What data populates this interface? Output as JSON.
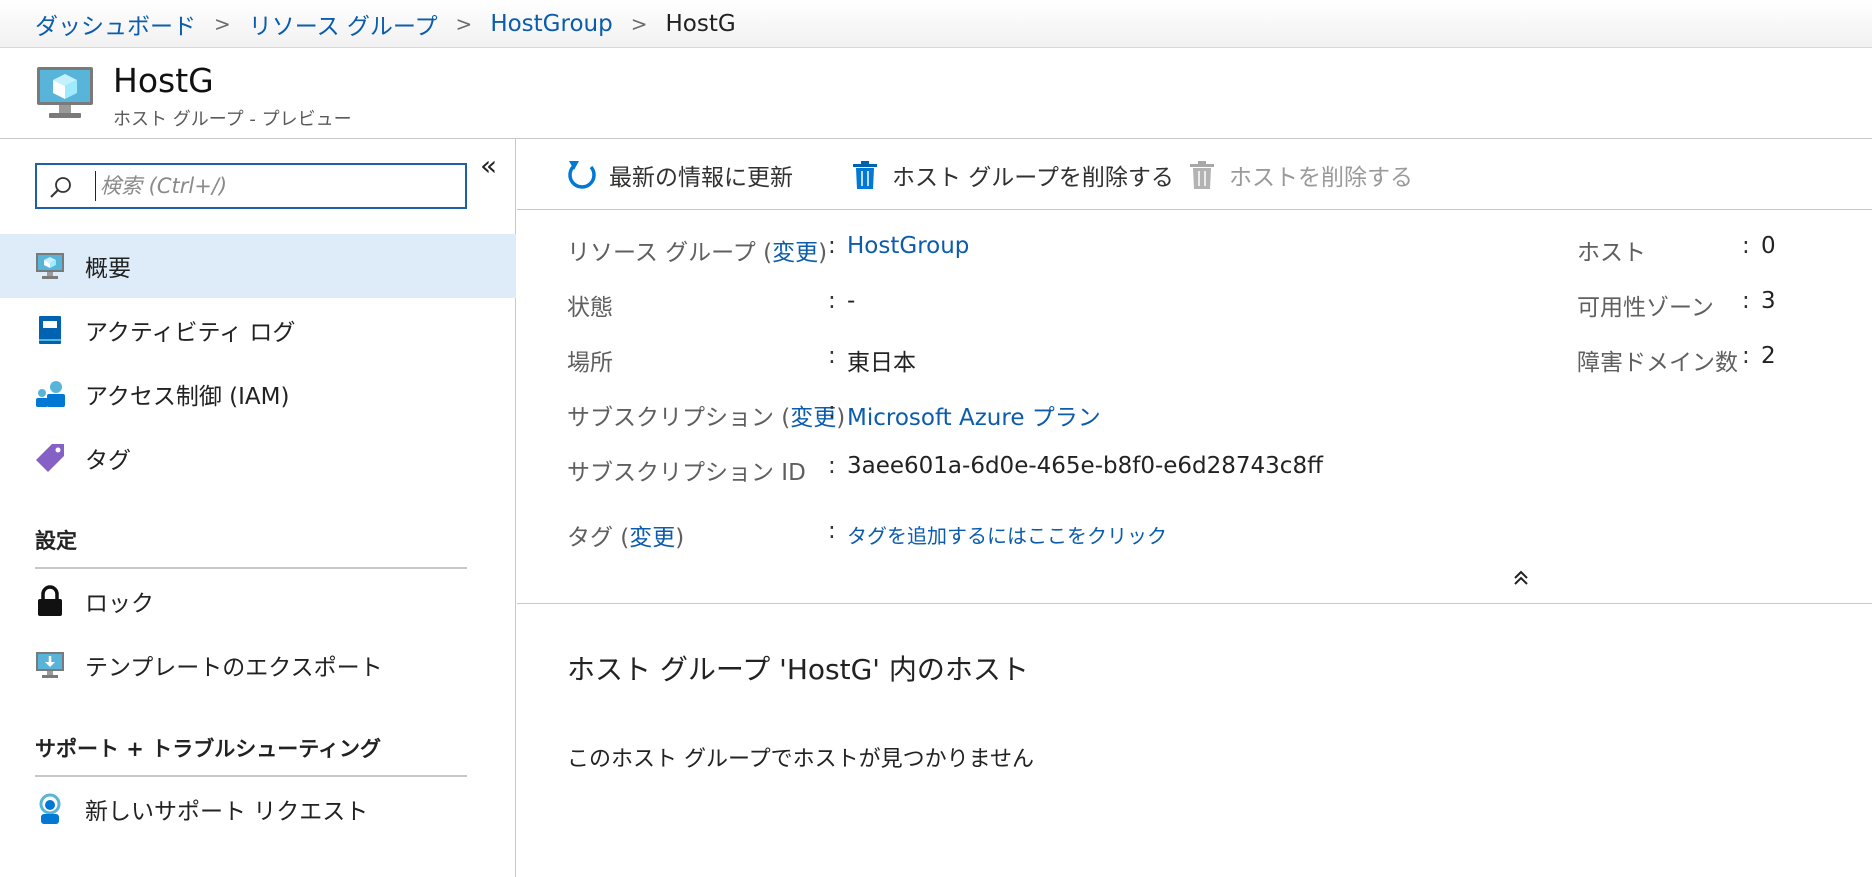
{
  "breadcrumb": {
    "items": [
      "ダッシュボード",
      "リソース グループ",
      "HostGroup"
    ],
    "current": "HostG"
  },
  "resource": {
    "title": "HostG",
    "subtitle": "ホスト グループ - プレビュー",
    "icon": "host-group-icon"
  },
  "sidebar": {
    "search_placeholder": "検索 (Ctrl+/)",
    "collapse_label": "«",
    "items": [
      {
        "label": "概要",
        "icon": "overview-icon"
      },
      {
        "label": "アクティビティ ログ",
        "icon": "activity-log-icon"
      },
      {
        "label": "アクセス制御 (IAM)",
        "icon": "access-control-icon"
      },
      {
        "label": "タグ",
        "icon": "tag-icon"
      }
    ],
    "settings_heading": "設定",
    "settings_items": [
      {
        "label": "ロック",
        "icon": "lock-icon"
      },
      {
        "label": "テンプレートのエクスポート",
        "icon": "export-template-icon"
      }
    ],
    "support_heading": "サポート + トラブルシューティング",
    "support_items": [
      {
        "label": "新しいサポート リクエスト",
        "icon": "support-request-icon"
      }
    ]
  },
  "toolbar": {
    "refresh": "最新の情報に更新",
    "delete_group": "ホスト グループを削除する",
    "delete_host": "ホストを削除する"
  },
  "essentials": {
    "resource_group_label": "リソース グループ",
    "change": "変更",
    "resource_group_value": "HostGroup",
    "status_label": "状態",
    "status_value": "-",
    "location_label": "場所",
    "location_value": "東日本",
    "subscription_label": "サブスクリプション",
    "subscription_value": "Microsoft Azure プラン",
    "subscription_id_label": "サブスクリプション ID",
    "subscription_id_value": "3aee601a-6d0e-465e-b8f0-e6d28743c8ff",
    "tags_label": "タグ",
    "tags_value": "タグを追加するにはここをクリック",
    "hosts_label": "ホスト",
    "hosts_value": "0",
    "zones_label": "可用性ゾーン",
    "zones_value": "3",
    "fault_domains_label": "障害ドメイン数",
    "fault_domains_value": "2",
    "colon": ":",
    "collapse_glyph": "⌃"
  },
  "hosts_section": {
    "title": "ホスト グループ 'HostG' 内のホスト",
    "empty_message": "このホスト グループでホストが見つかりません"
  },
  "colors": {
    "link": "#0b5cad",
    "active_bg": "#deecf9",
    "accent": "#0078d4"
  }
}
